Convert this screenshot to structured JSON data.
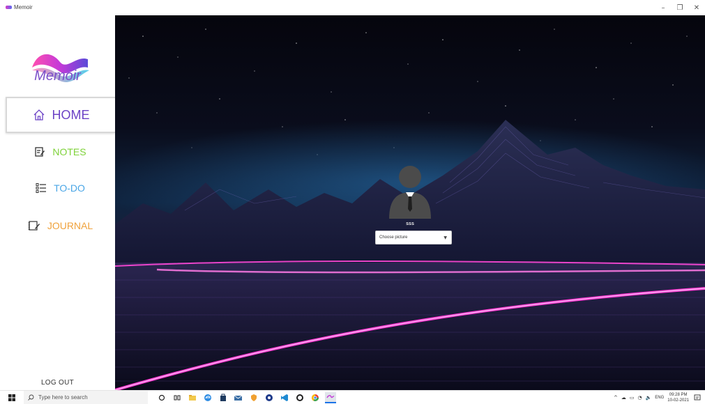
{
  "window": {
    "title": "Memoir",
    "controls": {
      "minimize": "–",
      "restore": "❐",
      "close": "✕"
    }
  },
  "sidebar": {
    "logo_text": "Memoir",
    "nav": [
      {
        "label": "HOME",
        "icon": "home-icon",
        "color": "#6c43c6",
        "active": true
      },
      {
        "label": "NOTES",
        "icon": "notes-icon",
        "color": "#7fd23a",
        "active": false
      },
      {
        "label": "TO-DO",
        "icon": "todo-list-icon",
        "color": "#4aa6e6",
        "active": false
      },
      {
        "label": "JOURNAL",
        "icon": "journal-icon",
        "color": "#f0a23c",
        "active": false
      }
    ],
    "logout_label": "LOG OUT"
  },
  "main": {
    "username": "sss",
    "picture_select": {
      "selected": "Choose picture"
    }
  },
  "taskbar": {
    "search_placeholder": "Type here to search",
    "apps": [
      "cortana-icon",
      "task-view-icon",
      "file-explorer-icon",
      "edge-icon",
      "store-icon",
      "mail-icon",
      "security-icon",
      "chrome-icon",
      "vscode-icon",
      "whatsapp-icon",
      "chrome-alt-icon",
      "memoir-app-icon"
    ],
    "tray": {
      "language": "ENG",
      "time": "09:28 PM",
      "date": "10-02-2021"
    }
  },
  "colors": {
    "accent": "#7b4fc9",
    "neon_pink": "#ff3cd6",
    "notes": "#7fd23a",
    "todo": "#4aa6e6",
    "journal": "#f0a23c"
  }
}
